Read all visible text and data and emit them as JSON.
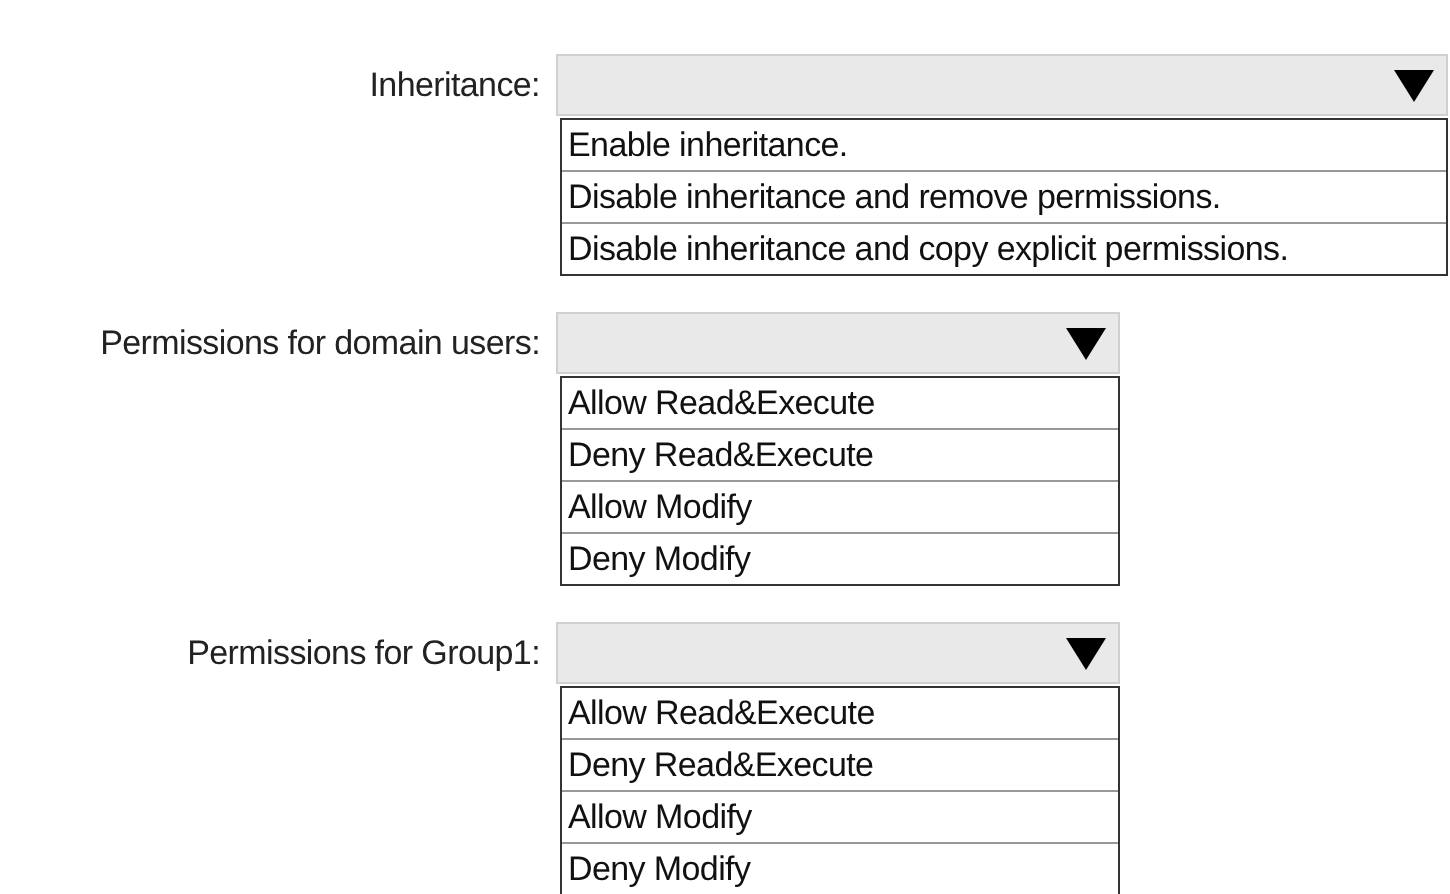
{
  "sections": [
    {
      "label": "Inheritance:",
      "kind": "wide",
      "options": [
        "Enable inheritance.",
        "Disable inheritance and remove permissions.",
        "Disable inheritance and copy explicit permissions."
      ]
    },
    {
      "label": "Permissions for domain users:",
      "kind": "narrow",
      "options": [
        "Allow Read&Execute",
        "Deny Read&Execute",
        "Allow Modify",
        "Deny Modify"
      ]
    },
    {
      "label": "Permissions for Group1:",
      "kind": "narrow",
      "options": [
        "Allow Read&Execute",
        "Deny Read&Execute",
        "Allow Modify",
        "Deny Modify"
      ]
    }
  ]
}
